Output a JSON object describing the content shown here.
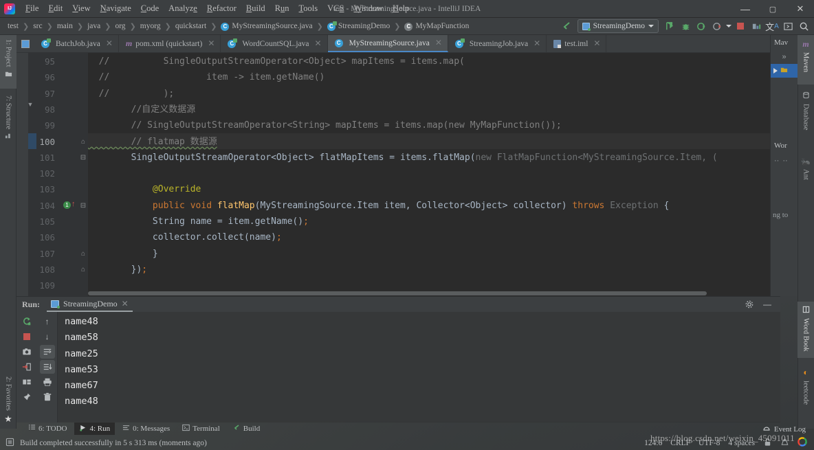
{
  "window": {
    "title": "test - MyStreamingSource.java - IntelliJ IDEA",
    "minimize": "–",
    "maximize": "▢",
    "close": "✕"
  },
  "menu": {
    "items": [
      "File",
      "Edit",
      "View",
      "Navigate",
      "Code",
      "Analyze",
      "Refactor",
      "Build",
      "Run",
      "Tools",
      "VCS",
      "Window",
      "Help"
    ]
  },
  "breadcrumb": {
    "segments": [
      {
        "label": "test",
        "icon": null
      },
      {
        "label": "src",
        "icon": null
      },
      {
        "label": "main",
        "icon": null
      },
      {
        "label": "java",
        "icon": null
      },
      {
        "label": "org",
        "icon": null
      },
      {
        "label": "myorg",
        "icon": null
      },
      {
        "label": "quickstart",
        "icon": null
      },
      {
        "label": "MyStreamingSource.java",
        "icon": "class-icon"
      },
      {
        "label": "StreamingDemo",
        "icon": "runnable-class-icon"
      },
      {
        "label": "MyMapFunction",
        "icon": "anonymous-class-icon"
      }
    ]
  },
  "toolbar": {
    "back_label": "↖",
    "run_config": "StreamingDemo",
    "buttons": [
      {
        "name": "run-button",
        "glyph": "▶"
      },
      {
        "name": "debug-button",
        "glyph": "🐞"
      },
      {
        "name": "run-with-coverage-button",
        "glyph": "▶"
      },
      {
        "name": "profiler-button",
        "glyph": "◷"
      },
      {
        "name": "stop-button",
        "glyph": "■"
      },
      {
        "name": "update-project-button",
        "glyph": "⬓"
      },
      {
        "name": "translate-button",
        "glyph": "文A"
      },
      {
        "name": "terminal-button",
        "glyph": "▣"
      },
      {
        "name": "search-everywhere-button",
        "glyph": "🔍"
      }
    ]
  },
  "editor_tabs": [
    {
      "label": "BatchJob.java",
      "icon": "runnable-class-icon",
      "active": false
    },
    {
      "label": "pom.xml (quickstart)",
      "icon": "maven-icon",
      "active": false
    },
    {
      "label": "WordCountSQL.java",
      "icon": "runnable-class-icon",
      "active": false
    },
    {
      "label": "MyStreamingSource.java",
      "icon": "class-icon",
      "active": true
    },
    {
      "label": "StreamingJob.java",
      "icon": "runnable-class-icon",
      "active": false
    },
    {
      "label": "test.iml",
      "icon": "module-icon",
      "active": false
    }
  ],
  "left_strip": [
    {
      "label": "1: Project",
      "icon": "folder-icon",
      "selected": true
    },
    {
      "label": "7: Structure",
      "icon": "structure-icon",
      "selected": false
    }
  ],
  "left_strip_bottom": [
    {
      "label": "2: Favorites",
      "icon": "star-icon"
    }
  ],
  "right_strip": [
    {
      "label": "Maven",
      "icon": "maven-icon",
      "selected": true
    },
    {
      "label": "Database",
      "icon": "database-icon",
      "selected": false
    },
    {
      "label": "Ant",
      "icon": "ant-icon",
      "selected": false
    }
  ],
  "right_strip_bottom": [
    {
      "label": "Word Book",
      "icon": "book-icon"
    },
    {
      "label": "leetcode",
      "icon": "leetcode-icon"
    }
  ],
  "maven_panel": {
    "title": "Mav",
    "expand": "»",
    "word_book_title": "Wor",
    "running_text": "ng to"
  },
  "editor": {
    "first_line": 95,
    "lines": [
      {
        "num": 95,
        "fold": "",
        "tokens": [
          {
            "t": "  //          SingleOutputStreamOperator<Object> mapItems = items.map(",
            "c": "cmt"
          }
        ]
      },
      {
        "num": 96,
        "fold": "",
        "tokens": [
          {
            "t": "  //                  item -> item.getName()",
            "c": "cmt"
          }
        ]
      },
      {
        "num": 97,
        "fold": "",
        "tokens": [
          {
            "t": "  //          );",
            "c": "cmt"
          }
        ]
      },
      {
        "num": 98,
        "fold": "",
        "tokens": [
          {
            "t": "        //自定义数据源",
            "c": "cmt"
          }
        ]
      },
      {
        "num": 99,
        "fold": "",
        "tokens": [
          {
            "t": "        // SingleOutputStreamOperator<String> mapItems = items.map(new MyMapFunction());",
            "c": "cmt"
          }
        ]
      },
      {
        "num": 100,
        "fold": "⌂",
        "tokens": [
          {
            "t": "        // flatmap 数据源",
            "c": "cmt-spell"
          }
        ]
      },
      {
        "num": 101,
        "fold": "⊟",
        "tokens": [
          {
            "t": "        SingleOutputStreamOperator<Object> flatMapItems = items.",
            "c": "typ"
          },
          {
            "t": "flatMap",
            "c": "typ"
          },
          {
            "t": "(",
            "c": "typ"
          },
          {
            "t": "new FlatMapFunction<MyStreamingSource.Item, (",
            "c": "fade"
          }
        ]
      },
      {
        "num": 102,
        "fold": "",
        "tokens": [
          {
            "t": "",
            "c": "typ"
          }
        ]
      },
      {
        "num": 103,
        "fold": "",
        "tokens": [
          {
            "t": "            @Override",
            "c": "ann"
          }
        ]
      },
      {
        "num": 104,
        "fold": "⊟",
        "tokens": [
          {
            "t": "            ",
            "c": "typ"
          },
          {
            "t": "public void ",
            "c": "kw"
          },
          {
            "t": "flatMap",
            "c": "mth"
          },
          {
            "t": "(MyStreamingSource.Item item, Collector<Object> collector) ",
            "c": "typ"
          },
          {
            "t": "throws ",
            "c": "kw"
          },
          {
            "t": "Exception",
            "c": "fade"
          },
          {
            "t": " {",
            "c": "typ"
          }
        ]
      },
      {
        "num": 105,
        "fold": "",
        "tokens": [
          {
            "t": "            String name = item.getName()",
            "c": "typ"
          },
          {
            "t": ";",
            "c": "semi"
          }
        ]
      },
      {
        "num": 106,
        "fold": "",
        "tokens": [
          {
            "t": "            collector.collect(name)",
            "c": "typ"
          },
          {
            "t": ";",
            "c": "semi"
          }
        ]
      },
      {
        "num": 107,
        "fold": "⌂",
        "tokens": [
          {
            "t": "            }",
            "c": "typ"
          }
        ]
      },
      {
        "num": 108,
        "fold": "⌂",
        "tokens": [
          {
            "t": "        })",
            "c": "typ"
          },
          {
            "t": ";",
            "c": "semi"
          }
        ]
      },
      {
        "num": 109,
        "fold": "",
        "tokens": [
          {
            "t": "",
            "c": "typ"
          }
        ]
      }
    ],
    "gutter_marker_line": 104,
    "gutter_marker_badge": "1",
    "caret_line": 100
  },
  "run_panel": {
    "label": "Run:",
    "tab": "StreamingDemo",
    "close": "✕",
    "settings_icon": "gear-icon",
    "hide_icon": "minimize-icon",
    "left_tools": [
      {
        "name": "rerun-button",
        "glyph": "↻"
      },
      {
        "name": "stop-button",
        "glyph": "■"
      },
      {
        "name": "screenshot-button",
        "glyph": "📷"
      },
      {
        "name": "export-button",
        "glyph": "⇥"
      },
      {
        "name": "layout-button",
        "glyph": "▤"
      },
      {
        "name": "pin-button",
        "glyph": "📌"
      }
    ],
    "mid_tools": [
      {
        "name": "up-button",
        "glyph": "↑"
      },
      {
        "name": "down-button",
        "glyph": "↓"
      },
      {
        "name": "soft-wrap-button",
        "glyph": "⏎",
        "on": true
      },
      {
        "name": "scroll-to-end-button",
        "glyph": "⇲",
        "on": true
      },
      {
        "name": "print-button",
        "glyph": "🖶"
      },
      {
        "name": "clear-all-button",
        "glyph": "🗑"
      }
    ],
    "console_lines": [
      "name48",
      "name58",
      "name25",
      "name53",
      "name67",
      "name48"
    ]
  },
  "tool_window_bar": [
    {
      "label": "6: TODO",
      "icon": "todo-icon",
      "active": false
    },
    {
      "label": "4: Run",
      "icon": "run-icon",
      "active": true
    },
    {
      "label": "0: Messages",
      "icon": "messages-icon",
      "active": false
    },
    {
      "label": "Terminal",
      "icon": "terminal-icon",
      "active": false
    },
    {
      "label": "Build",
      "icon": "build-icon",
      "active": false
    }
  ],
  "status_bar": {
    "message": "Build completed successfully in 5 s 313 ms (moments ago)",
    "message_icon": "build-status-icon",
    "caret_position": "124:6",
    "line_separator": "CRLF",
    "encoding": "UTF-8",
    "indent": "4 spaces",
    "lock_icon": "unlock-icon",
    "inspection_icon": "hector-icon",
    "google_icon": "google-icon",
    "event_log": "Event Log"
  },
  "watermark": {
    "text": "https://blog.csdn.net/weixin_45091011"
  },
  "colors": {
    "bg_chrome": "#3c3f41",
    "bg_editor": "#2b2b2b",
    "accent_blue": "#4a88c7",
    "accent_green": "#59a869",
    "accent_red": "#c75450",
    "comment": "#808080",
    "keyword": "#cc7832",
    "annotation": "#bbb529",
    "method": "#ffc66d",
    "text": "#a9b7c6",
    "warning_marker": "#bbb529"
  }
}
